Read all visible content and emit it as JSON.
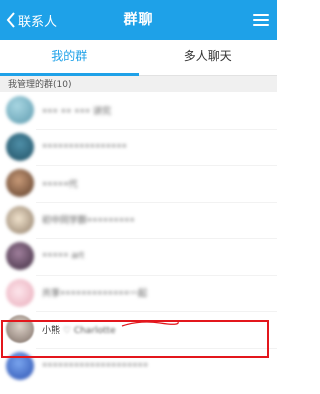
{
  "header": {
    "back_label": "联系人",
    "title": "群聊",
    "menu_icon": "hamburger-menu-icon",
    "background": "#1ea1e8"
  },
  "tabs": [
    {
      "label": "我的群",
      "active": true
    },
    {
      "label": "多人聊天",
      "active": false
    }
  ],
  "section": {
    "label": "我管理的群(10)"
  },
  "groups": [
    {
      "name": "•••  ••  •••  讲究",
      "avatar_color": "#7ab8c8",
      "blurred": true
    },
    {
      "name": "••••••••••••••••",
      "avatar_color": "#2e6e86",
      "blurred": true
    },
    {
      "name": "•••••代",
      "avatar_color": "#9b6b4a",
      "blurred": true
    },
    {
      "name": "初中同学群•••••••••",
      "avatar_color": "#d8c2a8",
      "blurred": true
    },
    {
      "name": "••••• art",
      "avatar_color": "#6a4f6b",
      "blurred": true
    },
    {
      "name": "共享•••••••••••••一起",
      "avatar_color": "#f3c9d3",
      "blurred": true
    },
    {
      "name": "小熊",
      "name_suffix": "♡ Charlotte",
      "avatar_color": "#b9aaa0",
      "blurred": false,
      "highlighted": true
    },
    {
      "name": "••••••••••••••••••••",
      "avatar_color": "#3f6fd0",
      "blurred": true
    }
  ],
  "highlight_color": "#e3161c"
}
